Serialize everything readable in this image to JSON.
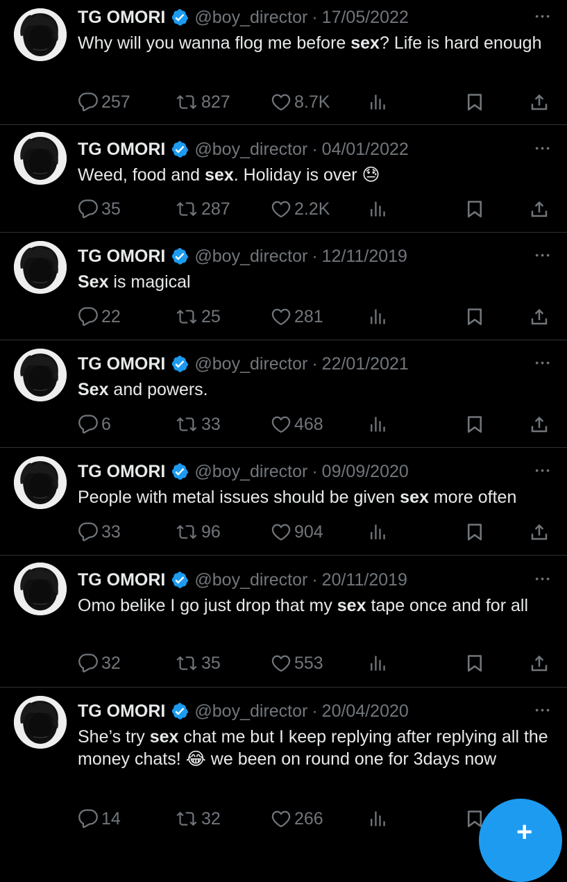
{
  "tweets": [
    {
      "name": "TG OMORI",
      "handle": "@boy_director",
      "date": "17/05/2022",
      "segments": [
        {
          "t": "Why will you wanna flog me before "
        },
        {
          "t": "sex",
          "b": true
        },
        {
          "t": "? Life is hard enough"
        }
      ],
      "replies": "257",
      "retweets": "827",
      "likes": "8.7K"
    },
    {
      "name": "TG OMORI",
      "handle": "@boy_director",
      "date": "04/01/2022",
      "segments": [
        {
          "t": "Weed, food and "
        },
        {
          "t": "sex",
          "b": true
        },
        {
          "t": ". Holiday is over 😓"
        }
      ],
      "replies": "35",
      "retweets": "287",
      "likes": "2.2K"
    },
    {
      "name": "TG OMORI",
      "handle": "@boy_director",
      "date": "12/11/2019",
      "segments": [
        {
          "t": "Sex",
          "b": true
        },
        {
          "t": " is magical"
        }
      ],
      "replies": "22",
      "retweets": "25",
      "likes": "281"
    },
    {
      "name": "TG OMORI",
      "handle": "@boy_director",
      "date": "22/01/2021",
      "segments": [
        {
          "t": "Sex",
          "b": true
        },
        {
          "t": " and powers."
        }
      ],
      "replies": "6",
      "retweets": "33",
      "likes": "468"
    },
    {
      "name": "TG OMORI",
      "handle": "@boy_director",
      "date": "09/09/2020",
      "segments": [
        {
          "t": "People with metal issues should be given "
        },
        {
          "t": "sex",
          "b": true
        },
        {
          "t": " more often"
        }
      ],
      "replies": "33",
      "retweets": "96",
      "likes": "904"
    },
    {
      "name": "TG OMORI",
      "handle": "@boy_director",
      "date": "20/11/2019",
      "segments": [
        {
          "t": "Omo belike I go just drop that my "
        },
        {
          "t": "sex",
          "b": true
        },
        {
          "t": " tape once and for all"
        }
      ],
      "replies": "32",
      "retweets": "35",
      "likes": "553"
    },
    {
      "name": "TG OMORI",
      "handle": "@boy_director",
      "date": "20/04/2020",
      "segments": [
        {
          "t": "She’s try "
        },
        {
          "t": "sex",
          "b": true
        },
        {
          "t": " chat me but I keep replying after replying all the money chats! 😂 we been on round one for 3days now"
        }
      ],
      "replies": "14",
      "retweets": "32",
      "likes": "266"
    }
  ],
  "colors": {
    "background": "#000000",
    "text": "#e7e9ea",
    "muted": "#71767b",
    "divider": "#2f3336",
    "verified": "#1d9bf0",
    "fab": "#1d9bf0"
  },
  "icons": {
    "reply": "reply-icon",
    "retweet": "retweet-icon",
    "like": "heart-icon",
    "views": "views-icon",
    "bookmark": "bookmark-icon",
    "share": "share-icon",
    "more": "more-icon",
    "verified": "verified-badge-icon",
    "compose": "plus-icon"
  }
}
